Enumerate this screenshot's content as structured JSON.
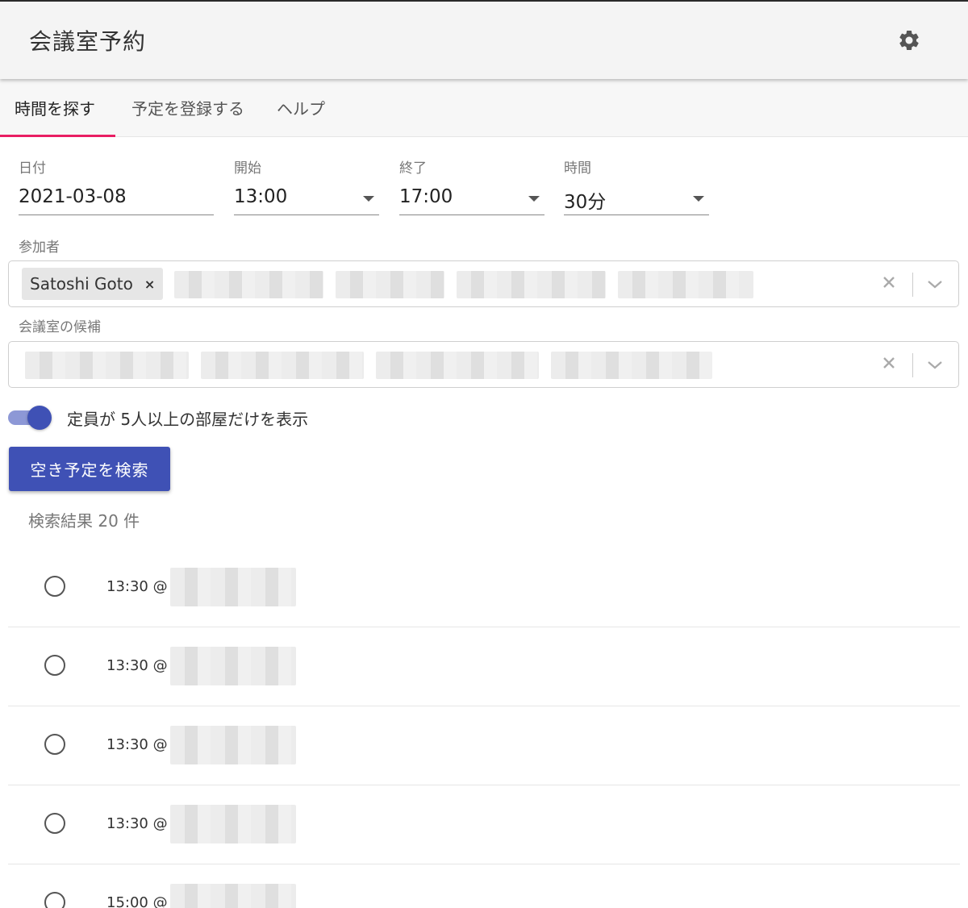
{
  "app": {
    "title": "会議室予約",
    "settings_icon": "gear-icon"
  },
  "tabs": [
    {
      "label": "時間を探す",
      "active": true
    },
    {
      "label": "予定を登録する",
      "active": false
    },
    {
      "label": "ヘルプ",
      "active": false
    }
  ],
  "form": {
    "date": {
      "label": "日付",
      "value": "2021-03-08"
    },
    "start": {
      "label": "開始",
      "value": "13:00"
    },
    "end": {
      "label": "終了",
      "value": "17:00"
    },
    "duration": {
      "label": "時間",
      "value": "30分"
    }
  },
  "participants": {
    "label": "参加者",
    "chips": [
      {
        "label": "Satoshi Goto"
      }
    ],
    "remove_symbol": "×"
  },
  "rooms": {
    "label": "会議室の候補"
  },
  "toggle": {
    "label": "定員が 5人以上の部屋だけを表示",
    "checked": true
  },
  "search_button": {
    "label": "空き予定を検索"
  },
  "results": {
    "count_label": "検索結果 20 件",
    "items": [
      {
        "time": "13:30 @"
      },
      {
        "time": "13:30 @"
      },
      {
        "time": "13:30 @"
      },
      {
        "time": "13:30 @"
      },
      {
        "time": "15:00 @"
      }
    ]
  },
  "colors": {
    "primary": "#3f51b5",
    "tab_indicator": "#e91e63",
    "header_bg": "#f4f4f4"
  }
}
